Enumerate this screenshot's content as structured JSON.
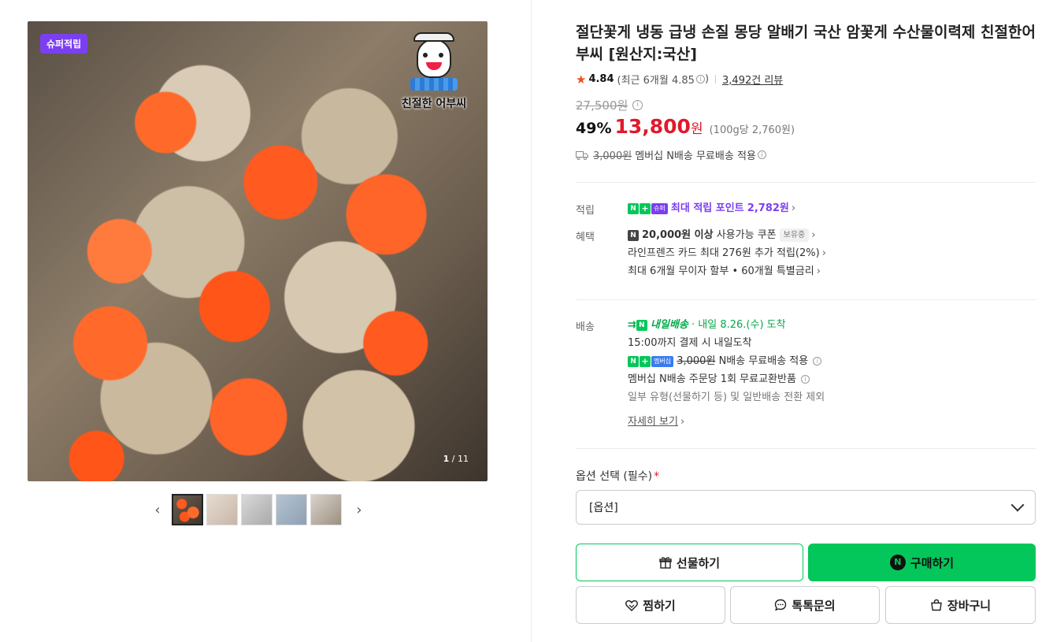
{
  "gallery": {
    "badge": "슈퍼적립",
    "brand": "친절한 어부씨",
    "counter_current": "1",
    "counter_total": "/ 11",
    "prev_label": "‹",
    "next_label": "›",
    "thumbs": [
      "thumb-1",
      "thumb-2",
      "thumb-3",
      "thumb-4",
      "thumb-5"
    ]
  },
  "product": {
    "title": "절단꽃게 냉동 급냉 손질 몽당 알배기 국산 암꽃게 수산물이력제 친절한어부씨 [원산지:국산]",
    "rating": "4.84",
    "recent_rating": "(최근 6개월 4.85",
    "recent_close": ")",
    "reviews": "3,492건 리뷰",
    "original_price": "27,500원",
    "discount": "49%",
    "price": "13,800",
    "price_unit": "원",
    "unit_price": "(100g당 2,760원)",
    "shipping_old": "3,000원",
    "shipping_text": "멤버십 N배송 무료배송 적용"
  },
  "points": {
    "label": "적립",
    "text": "최대 적립 포인트",
    "amount": "2,782원",
    "super_tag": "슈퍼",
    "n_tag": "N",
    "plus_tag": "+"
  },
  "benefits": {
    "label": "혜택",
    "coupon_amount": "20,000원 이상",
    "coupon_text": "사용가능 쿠폰",
    "coupon_pill": "보유중",
    "card": "라인프렌즈 카드 최대 276원 추가 적립(2%)",
    "installment": "최대 6개월 무이자 할부 • 60개월 특별금리"
  },
  "delivery": {
    "label": "배송",
    "tomorrow": "내일배송",
    "arrival": "· 내일 8.26.(수) 도착",
    "cutoff": "15:00까지 결제 시 내일도착",
    "member_tag": "멤버십",
    "fee_old": "3,000원",
    "fee_text": "N배송 무료배송 적용",
    "exchange": "멤버십 N배송 주문당 1회 무료교환반품",
    "note": "일부 유형(선물하기 등) 및 일반배송 전환 제외",
    "details_link": "자세히 보기"
  },
  "options": {
    "label": "옵션 선택 (필수)",
    "required_mark": "*",
    "select_value": "[옵션]"
  },
  "buttons": {
    "gift": "선물하기",
    "buy": "구매하기",
    "like": "찜하기",
    "talk": "톡톡문의",
    "cart": "장바구니"
  },
  "colors": {
    "naver_green": "#03c75a",
    "price_red": "#e0192c",
    "super_purple": "#7b3ff2"
  }
}
